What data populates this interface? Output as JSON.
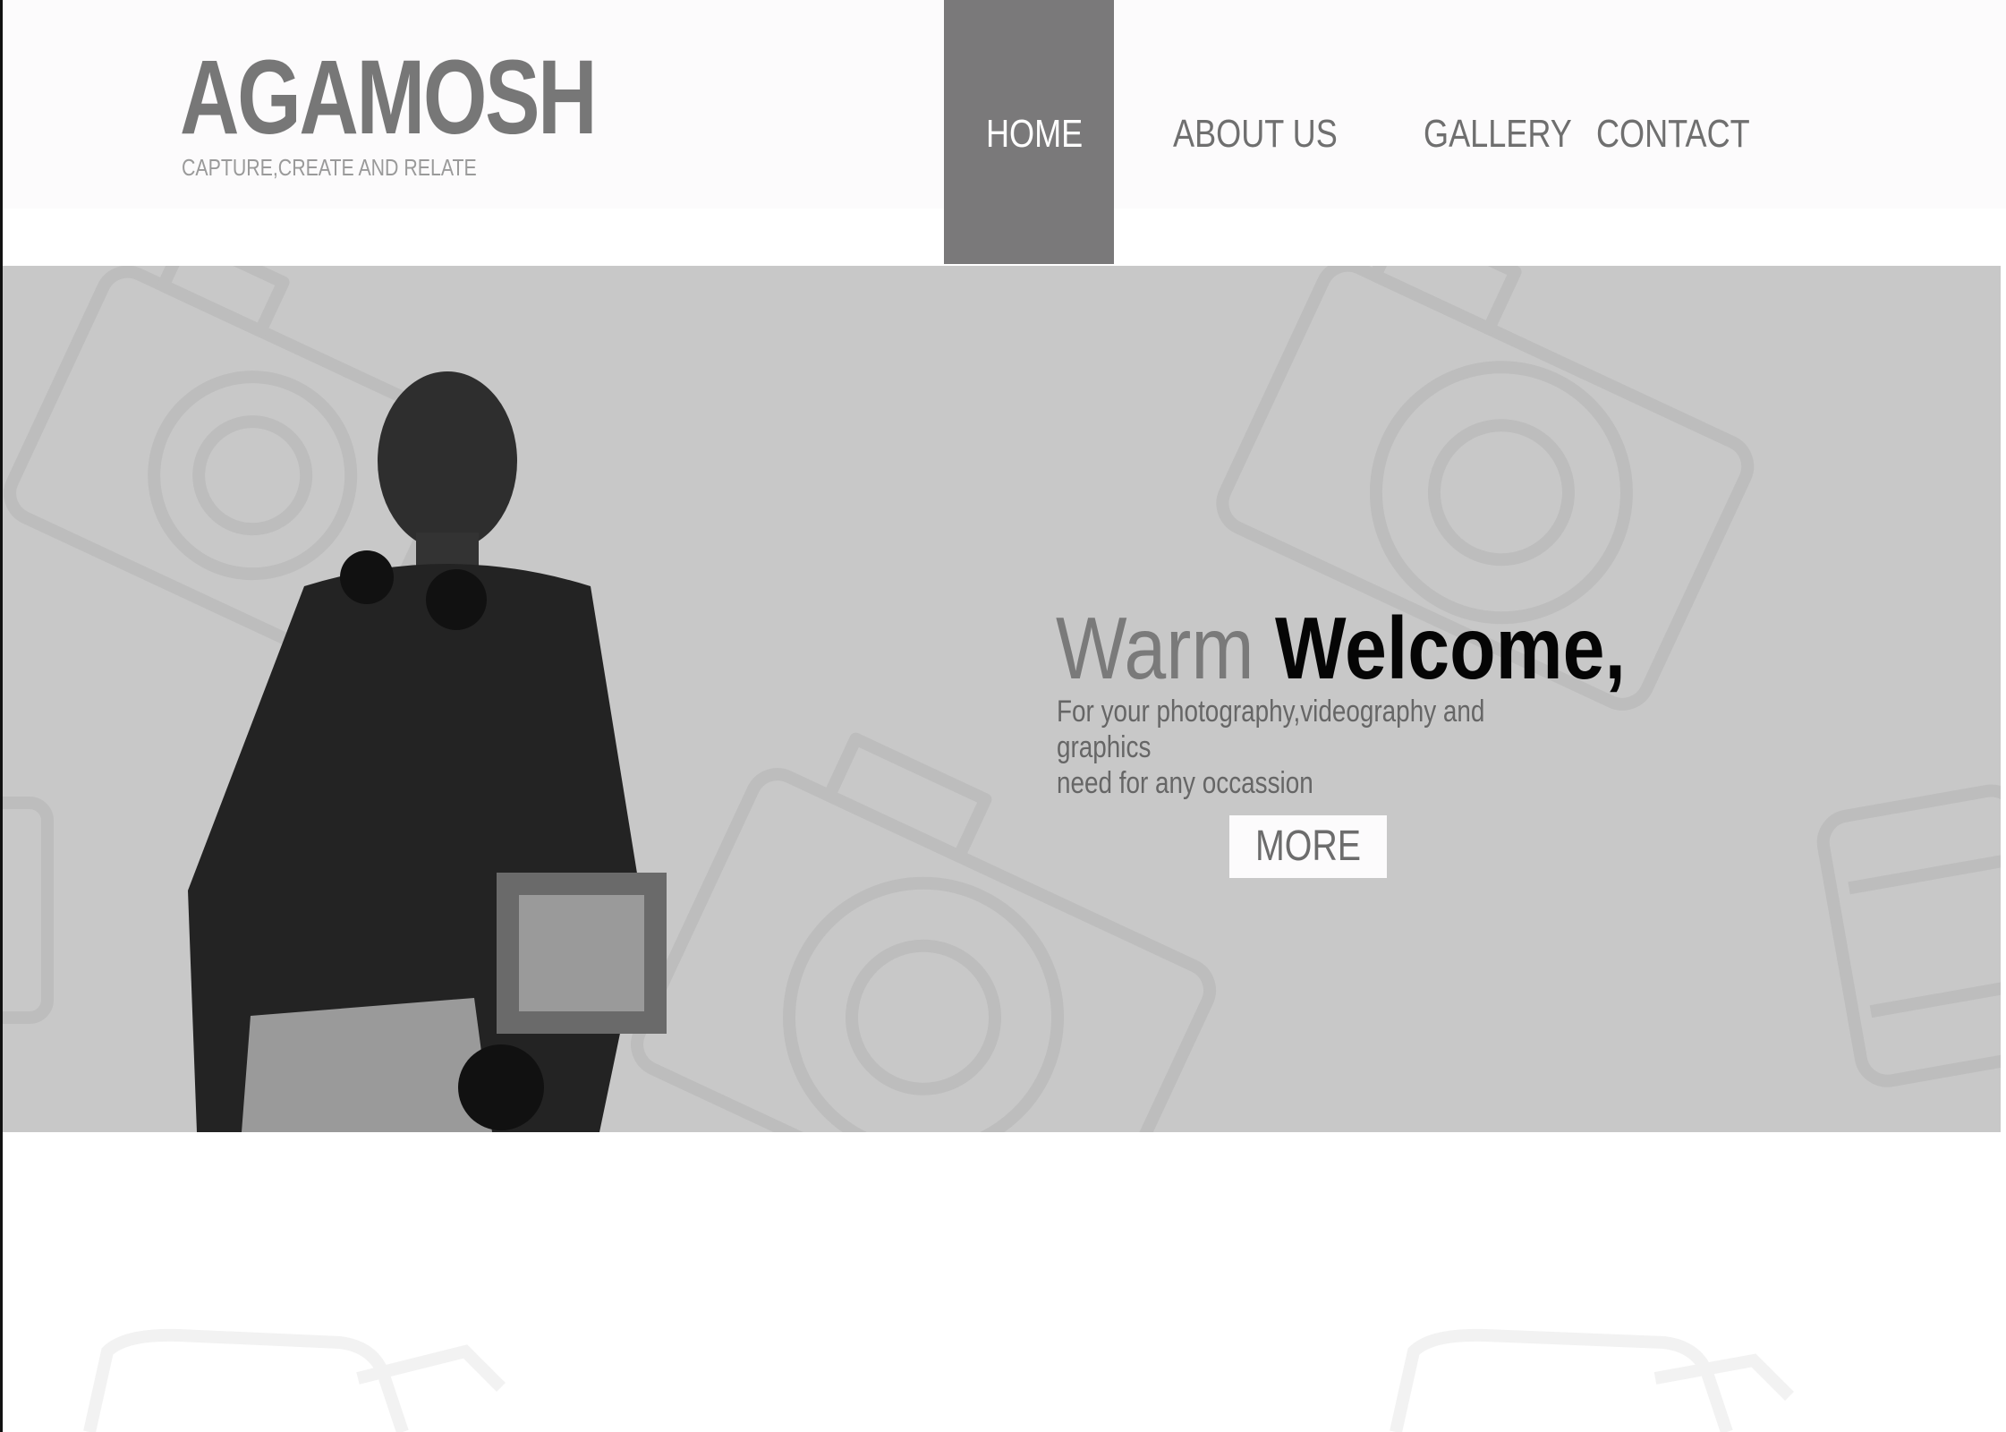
{
  "brand": {
    "name": "AGAMOSH",
    "tagline": "CAPTURE,CREATE AND RELATE"
  },
  "nav": {
    "items": [
      {
        "label": "HOME",
        "active": true
      },
      {
        "label": "ABOUT US",
        "active": false
      },
      {
        "label": "GALLERY",
        "active": false
      },
      {
        "label": "CONTACT",
        "active": false
      }
    ]
  },
  "hero": {
    "welcome_warm": "Warm",
    "welcome_strong": "Welcome,",
    "subtitle_line1": "For your photography,videography and graphics",
    "subtitle_line2": "need for any occassion",
    "more_label": "MORE"
  },
  "colors": {
    "header_bg": "#fcfbfc",
    "nav_active_bg": "#7a797a",
    "hero_bg": "#c8c8c8",
    "text_gray": "#777777"
  }
}
